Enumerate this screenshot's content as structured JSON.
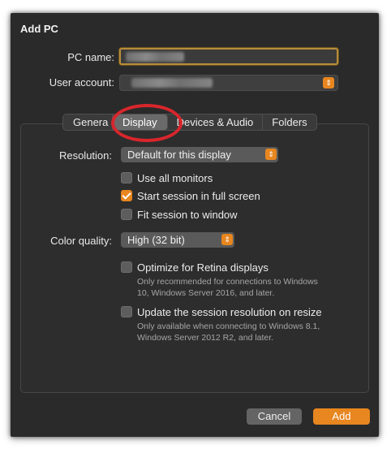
{
  "dialog": {
    "title": "Add PC"
  },
  "form": {
    "pc_name_label": "PC name:",
    "user_account_label": "User account:"
  },
  "tabs": [
    {
      "label": "Genera"
    },
    {
      "label": "Display"
    },
    {
      "label": "Devices & Audio"
    },
    {
      "label": "Folders"
    }
  ],
  "display": {
    "resolution_label": "Resolution:",
    "resolution_value": "Default for this display",
    "use_all_monitors": "Use all monitors",
    "start_full_screen": "Start session in full screen",
    "fit_to_window": "Fit session to window",
    "color_quality_label": "Color quality:",
    "color_quality_value": "High (32 bit)",
    "optimize_retina": "Optimize for Retina displays",
    "optimize_retina_note_1": "Only recommended for connections to Windows",
    "optimize_retina_note_2": "10, Windows Server 2016, and later.",
    "update_resolution": "Update the session resolution on resize",
    "update_resolution_note_1": "Only available when connecting to Windows 8.1,",
    "update_resolution_note_2": "Windows Server 2012 R2, and later."
  },
  "buttons": {
    "cancel": "Cancel",
    "add": "Add"
  },
  "colors": {
    "accent": "#e8861f",
    "highlight_ring": "#d8262c"
  }
}
